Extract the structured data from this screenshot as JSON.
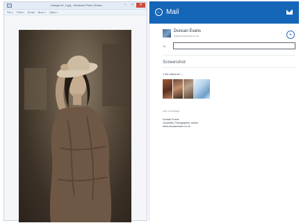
{
  "photo_viewer": {
    "title": "vintage 04_2.jpg - Windows Photo Viewer",
    "window_buttons": [
      "–",
      "□",
      "✕"
    ],
    "menus": [
      "File",
      "Print",
      "Email",
      "Burn",
      "Open"
    ]
  },
  "mail": {
    "header_title": "Mail",
    "sender": {
      "name": "Duncan Evans",
      "email": "d@duncanevans.co.uk"
    },
    "to_label": "To",
    "to_value": "",
    "subject": "Screenshot",
    "files_attached": "1 file attached ⌄",
    "add_message_placeholder": "Add a message",
    "signature": {
      "name": "Duncan Evans",
      "role": "Journalist, Photographer, Author",
      "website": "www.duncanevans.co.uk"
    }
  },
  "icons": {
    "back": "back-arrow-icon",
    "envelope": "envelope-icon",
    "send": "send-icon"
  },
  "colors": {
    "mail_header": "#1565b8",
    "photo_tone": "sepia"
  }
}
